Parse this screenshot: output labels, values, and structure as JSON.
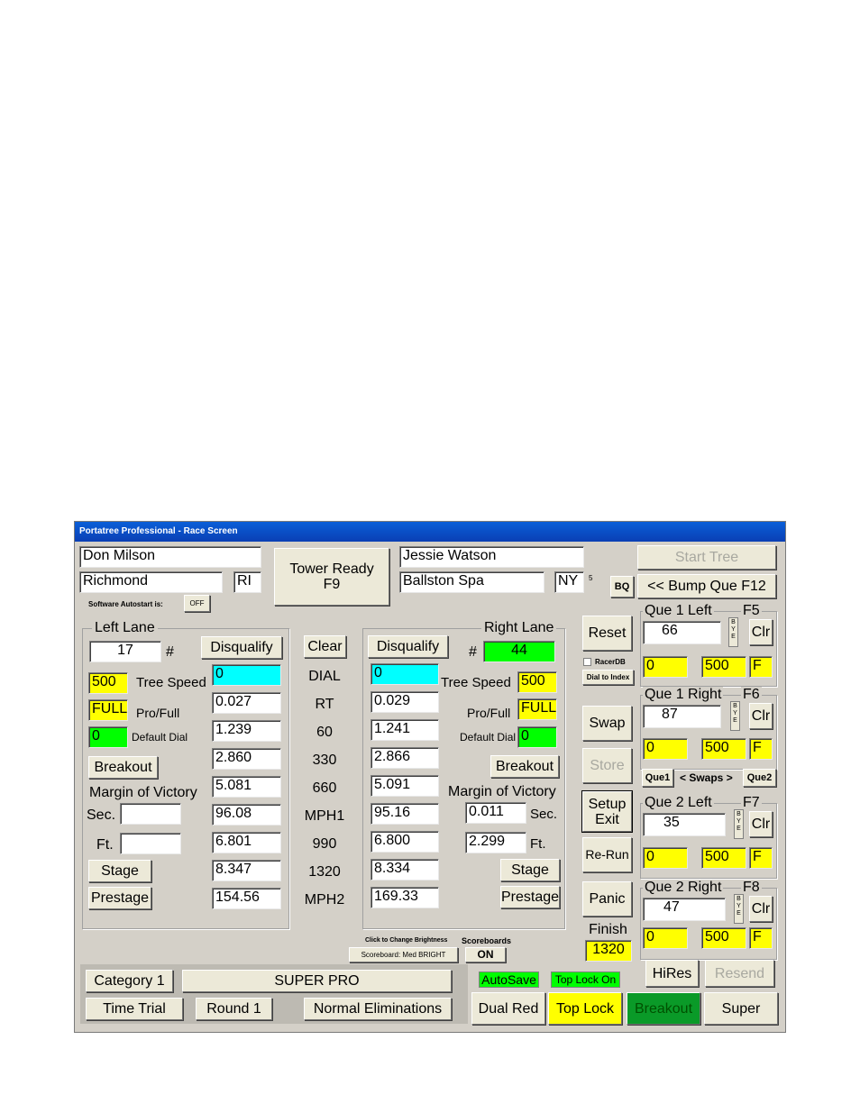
{
  "window": {
    "title": "Portatree Professional - Race Screen"
  },
  "left": {
    "name": "Don Milson",
    "city": "Richmond",
    "state": "RI",
    "lane_label": "Left Lane",
    "car_number": "17",
    "hash": "#",
    "disqualify": "Disqualify",
    "tree_speed_value": "500",
    "tree_speed_label": "Tree Speed",
    "pro_full_value": "FULL",
    "pro_full_label": "Pro/Full",
    "default_dial_value": "0",
    "default_dial_label": "Default Dial",
    "breakout": "Breakout",
    "margin_label": "Margin of Victory",
    "sec_label": "Sec.",
    "ft_label": "Ft.",
    "sec_value": "",
    "ft_value": "",
    "stage": "Stage",
    "prestage": "Prestage",
    "results": {
      "dial": "0",
      "rt": "0.027",
      "t60": "1.239",
      "t330": "2.860",
      "t660": "5.081",
      "mph1": "96.08",
      "t990": "6.801",
      "t1320": "8.347",
      "mph2": "154.56"
    }
  },
  "right": {
    "name": "Jessie Watson",
    "city": "Ballston Spa",
    "state": "NY",
    "small_num": "5",
    "lane_label": "Right Lane",
    "car_number": "44",
    "hash": "#",
    "disqualify": "Disqualify",
    "tree_speed_value": "500",
    "tree_speed_label": "Tree Speed",
    "pro_full_value": "FULL",
    "pro_full_label": "Pro/Full",
    "default_dial_value": "0",
    "default_dial_label": "Default Dial",
    "breakout": "Breakout",
    "margin_label": "Margin of Victory",
    "sec_label": "Sec.",
    "ft_label": "Ft.",
    "sec_value": "0.011",
    "ft_value": "2.299",
    "stage": "Stage",
    "prestage": "Prestage",
    "results": {
      "dial": "0",
      "rt": "0.029",
      "t60": "1.241",
      "t330": "2.866",
      "t660": "5.091",
      "mph1": "95.16",
      "t990": "6.800",
      "t1320": "8.334",
      "mph2": "169.33"
    }
  },
  "center": {
    "tower_ready": "Tower Ready",
    "tower_key": "F9",
    "clear": "Clear",
    "rows": [
      "DIAL",
      "RT",
      "60",
      "330",
      "660",
      "MPH1",
      "990",
      "1320",
      "MPH2"
    ]
  },
  "autostart": {
    "label": "Software Autostart is:",
    "value": "OFF"
  },
  "controls": {
    "bq": "BQ",
    "reset": "Reset",
    "racerdb": "RacerDB",
    "dial_to_index": "Dial to Index",
    "swap": "Swap",
    "store": "Store",
    "setup": "Setup",
    "exit": "Exit",
    "rerun": "Re-Run",
    "panic": "Panic",
    "finish_label": "Finish",
    "finish_value": "1320"
  },
  "queue": {
    "start_tree": "Start Tree",
    "bump_que": "<< Bump Que  F12",
    "que1_label": "Que1",
    "swaps_label": "< Swaps >",
    "que2_label": "Que2",
    "bye": "B Y E",
    "clr": "Clr",
    "slots": [
      {
        "label": "Que 1 Left",
        "key": "F5",
        "number": "66",
        "v1": "0",
        "v2": "500",
        "v3": "F"
      },
      {
        "label": "Que 1 Right",
        "key": "F6",
        "number": "87",
        "v1": "0",
        "v2": "500",
        "v3": "F"
      },
      {
        "label": "Que 2 Left",
        "key": "F7",
        "number": "35",
        "v1": "0",
        "v2": "500",
        "v3": "F"
      },
      {
        "label": "Que 2 Right",
        "key": "F8",
        "number": "47",
        "v1": "0",
        "v2": "500",
        "v3": "F"
      }
    ]
  },
  "scoreboard": {
    "click_label": "Click to Change Brightness",
    "title": "Scoreboards",
    "brightness": "Scoreboard: Med BRIGHT",
    "state": "ON"
  },
  "bottom": {
    "category": "Category 1",
    "class": "SUPER PRO",
    "time_trial": "Time Trial",
    "round": "Round 1",
    "eliminations": "Normal Eliminations",
    "autosave": "AutoSave",
    "top_lock_on": "Top Lock On",
    "dual_red": "Dual Red",
    "top_lock": "Top Lock",
    "breakout": "Breakout",
    "super": "Super",
    "hires": "HiRes",
    "resend": "Resend"
  },
  "colors": {
    "yellow": "#ffff00",
    "green": "#00ff00",
    "cyan": "#00ffff",
    "dark_green": "#0a9a28",
    "title_blue": "#0a4fc8"
  }
}
